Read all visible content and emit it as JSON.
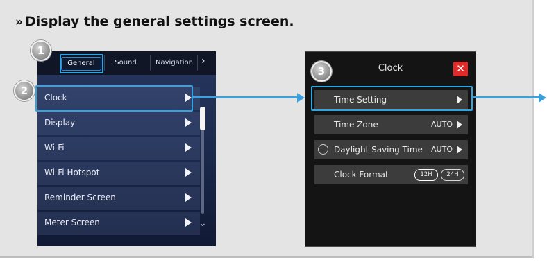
{
  "heading": {
    "chevron": "»",
    "text": "Display the general settings screen."
  },
  "steps": {
    "one": "1",
    "two": "2",
    "three": "3"
  },
  "general_screen": {
    "tabs": [
      {
        "label": "General",
        "active": true
      },
      {
        "label": "Sound",
        "active": false
      },
      {
        "label": "Navigation",
        "active": false
      }
    ],
    "menu_items": [
      {
        "label": "Clock"
      },
      {
        "label": "Display"
      },
      {
        "label": "Wi-Fi"
      },
      {
        "label": "Wi-Fi Hotspot"
      },
      {
        "label": "Reminder Screen"
      },
      {
        "label": "Meter Screen"
      }
    ]
  },
  "clock_screen": {
    "title": "Clock",
    "close_symbol": "✕",
    "rows": [
      {
        "label": "Time Setting",
        "value": ""
      },
      {
        "label": "Time Zone",
        "value": "AUTO"
      },
      {
        "label": "Daylight Saving Time",
        "value": "AUTO"
      },
      {
        "label": "Clock Format",
        "value": ""
      }
    ],
    "info_symbol": "i",
    "format_options": [
      "12H",
      "24H"
    ]
  },
  "colors": {
    "highlight": "#2fa6e3",
    "arrow": "#3aa1dd",
    "close": "#e02b2b"
  }
}
